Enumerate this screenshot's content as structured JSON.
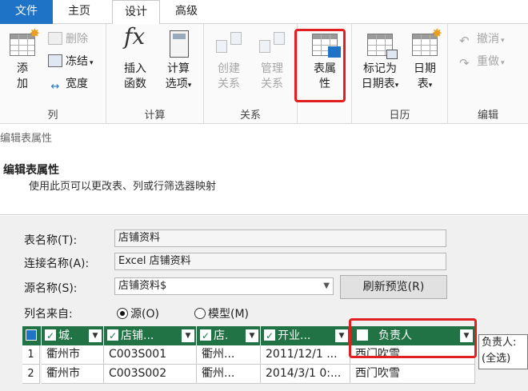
{
  "tabs": {
    "file": "文件",
    "home": "主页",
    "design": "设计",
    "advanced": "高级"
  },
  "ribbon": {
    "columns": {
      "add": [
        "添",
        "加"
      ],
      "delete": "删除",
      "freeze": "冻结",
      "width": "宽度",
      "label": "列"
    },
    "calc": {
      "insert_fn": [
        "插入",
        "函数"
      ],
      "calc_options": [
        "计算",
        "选项"
      ],
      "label": "计算"
    },
    "relations": {
      "create": [
        "创建",
        "关系"
      ],
      "manage": [
        "管理",
        "关系"
      ],
      "label": "关系"
    },
    "table_props": [
      "表属",
      "性"
    ],
    "calendar": {
      "mark_date": [
        "标记为",
        "日期表"
      ],
      "date_table": [
        "日期",
        "表"
      ],
      "label": "日历"
    },
    "edit": {
      "undo": "撤消",
      "redo": "重做",
      "label": "编辑"
    }
  },
  "editor": {
    "window_title": "编辑表属性",
    "heading": "编辑表属性",
    "description": "使用此页可以更改表、列或行筛选器映射"
  },
  "form": {
    "table_name_label": "表名称(T):",
    "table_name_value": "店铺资料",
    "conn_name_label": "连接名称(A):",
    "conn_name_value": "Excel 店铺资料",
    "source_name_label": "源名称(S):",
    "source_name_value": "店铺资料$",
    "refresh_label": "刷新预览(R)",
    "col_names_from_label": "列名来自:",
    "radio_source": "源(O)",
    "radio_model": "模型(M)"
  },
  "grid": {
    "headers": [
      "城.",
      "店铺...",
      "店.",
      "开业...",
      "负责人"
    ],
    "rows": [
      {
        "num": "1",
        "cells": [
          "衢州市",
          "C003S001",
          "衢州...",
          "2011/12/1 ...",
          "西门吹雪"
        ]
      },
      {
        "num": "2",
        "cells": [
          "衢州市",
          "C003S002",
          "衢州...",
          "2014/3/1 0:...",
          "西门吹雪"
        ]
      }
    ],
    "tooltip": [
      "负责人:",
      "(全选)"
    ]
  },
  "colors": {
    "file_tab": "#1f73c7",
    "grid_header": "#217346",
    "highlight": "#e02020"
  }
}
